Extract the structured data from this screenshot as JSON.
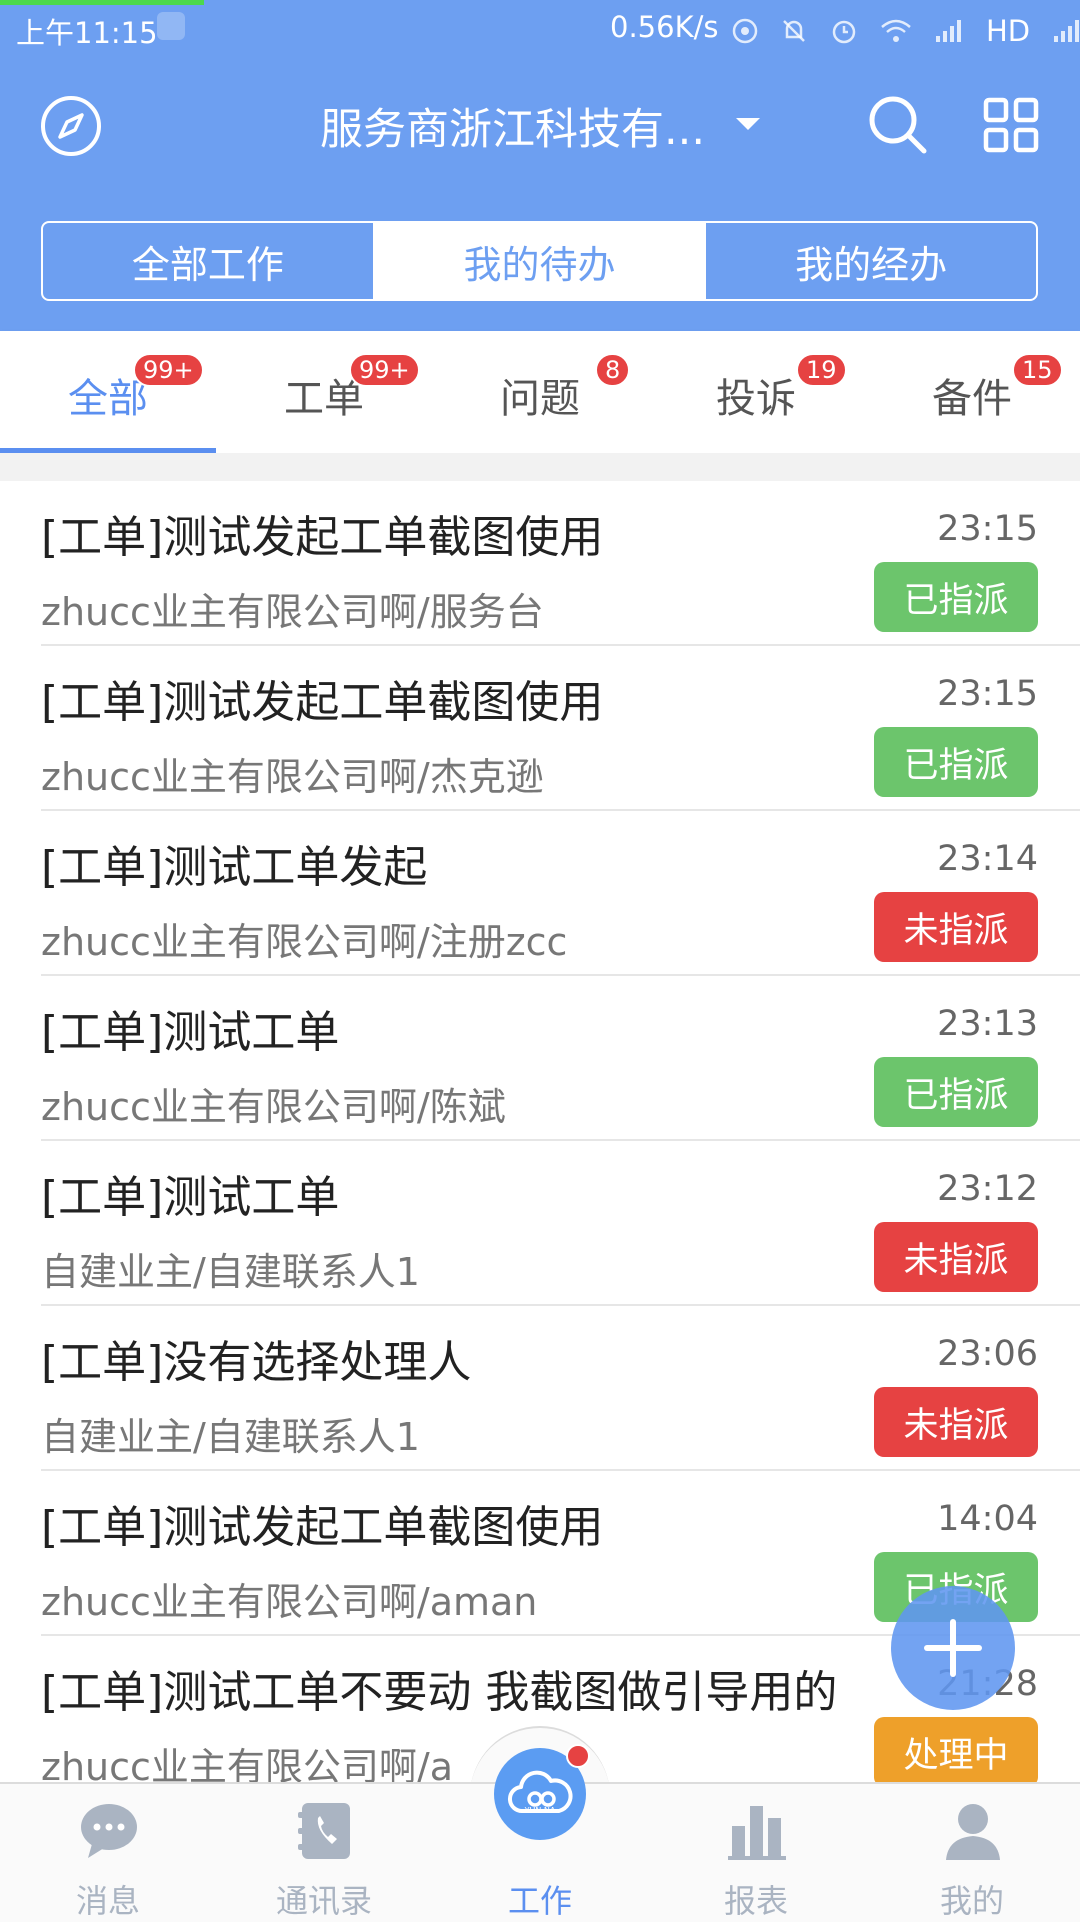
{
  "status_bar": {
    "time": "上午11:15",
    "net_speed": "0.56K/s",
    "network_label": "HD"
  },
  "header": {
    "title": "服务商浙江科技有...",
    "segments": [
      {
        "label": "全部工作",
        "active": false
      },
      {
        "label": "我的待办",
        "active": true
      },
      {
        "label": "我的经办",
        "active": false
      }
    ]
  },
  "category_tabs": [
    {
      "label": "全部",
      "badge": "99+",
      "active": true
    },
    {
      "label": "工单",
      "badge": "99+",
      "active": false
    },
    {
      "label": "问题",
      "badge": "8",
      "active": false
    },
    {
      "label": "投诉",
      "badge": "19",
      "active": false
    },
    {
      "label": "备件",
      "badge": "15",
      "active": false
    }
  ],
  "work_orders": [
    {
      "title": "[工单]测试发起工单截图使用",
      "subtitle": "zhucc业主有限公司啊/服务台",
      "time": "23:15",
      "status": "已指派"
    },
    {
      "title": "[工单]测试发起工单截图使用",
      "subtitle": "zhucc业主有限公司啊/杰克逊",
      "time": "23:15",
      "status": "已指派"
    },
    {
      "title": "[工单]测试工单发起",
      "subtitle": "zhucc业主有限公司啊/注册zcc",
      "time": "23:14",
      "status": "未指派"
    },
    {
      "title": "[工单]测试工单",
      "subtitle": "zhucc业主有限公司啊/陈斌",
      "time": "23:13",
      "status": "已指派"
    },
    {
      "title": "[工单]测试工单",
      "subtitle": "自建业主/自建联系人1",
      "time": "23:12",
      "status": "未指派"
    },
    {
      "title": "[工单]没有选择处理人",
      "subtitle": "自建业主/自建联系人1",
      "time": "23:06",
      "status": "未指派"
    },
    {
      "title": "[工单]测试发起工单截图使用",
      "subtitle": "zhucc业主有限公司啊/aman",
      "time": "14:04",
      "status": "已指派"
    },
    {
      "title": "[工单]测试工单不要动  我截图做引导用的",
      "subtitle": "zhucc业主有限公司啊/a",
      "time": "21:28",
      "status": "处理中"
    }
  ],
  "status_colors": {
    "已指派": "#6cc56c",
    "未指派": "#e64242",
    "处理中": "#eea02a"
  },
  "bottom_nav": [
    {
      "label": "消息",
      "icon": "chat-bubble-icon",
      "active": false
    },
    {
      "label": "通讯录",
      "icon": "contacts-phone-icon",
      "active": false
    },
    {
      "label": "工作",
      "icon": "cloud-work-icon",
      "active": true
    },
    {
      "label": "报表",
      "icon": "bar-chart-icon",
      "active": false
    },
    {
      "label": "我的",
      "icon": "person-icon",
      "active": false
    }
  ],
  "center_logo_text": "YUN NA",
  "theme": {
    "primary": "#6d9ff1",
    "accent": "#5b8ff0"
  }
}
